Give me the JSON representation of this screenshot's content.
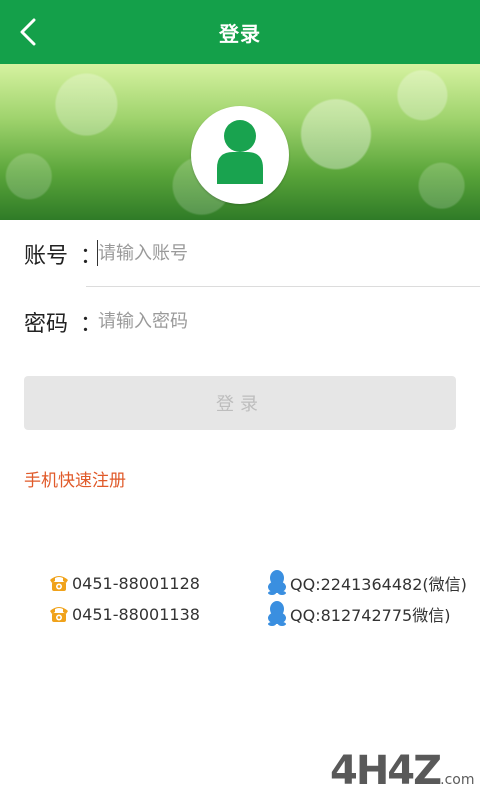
{
  "header": {
    "title": "登录",
    "back_icon": "chevron-left-icon"
  },
  "colors": {
    "header_bg": "#14a04a",
    "accent_green": "#19a34f",
    "register_link": "#e05a2a",
    "button_bg": "#e6e6e6",
    "button_text": "#bdbdbd"
  },
  "banner": {
    "avatar_icon": "user-avatar-icon"
  },
  "form": {
    "account": {
      "label": "账号",
      "colon": "：",
      "value": "",
      "placeholder": "请输入账号"
    },
    "password": {
      "label": "密码",
      "colon": "：",
      "value": "",
      "placeholder": "请输入密码"
    },
    "login_button": "登录",
    "register_link": "手机快速注册"
  },
  "contacts": [
    {
      "type": "phone",
      "icon": "phone-icon",
      "text": "0451-88001128"
    },
    {
      "type": "phone",
      "icon": "phone-icon",
      "text": "0451-88001138"
    },
    {
      "type": "qq",
      "icon": "qq-penguin-icon",
      "text": "QQ:2241364482(微信)"
    },
    {
      "type": "qq",
      "icon": "qq-penguin-icon",
      "text": "QQ:812742775微信)"
    }
  ],
  "watermark": {
    "text": "4H4Z",
    "suffix": ".com"
  }
}
